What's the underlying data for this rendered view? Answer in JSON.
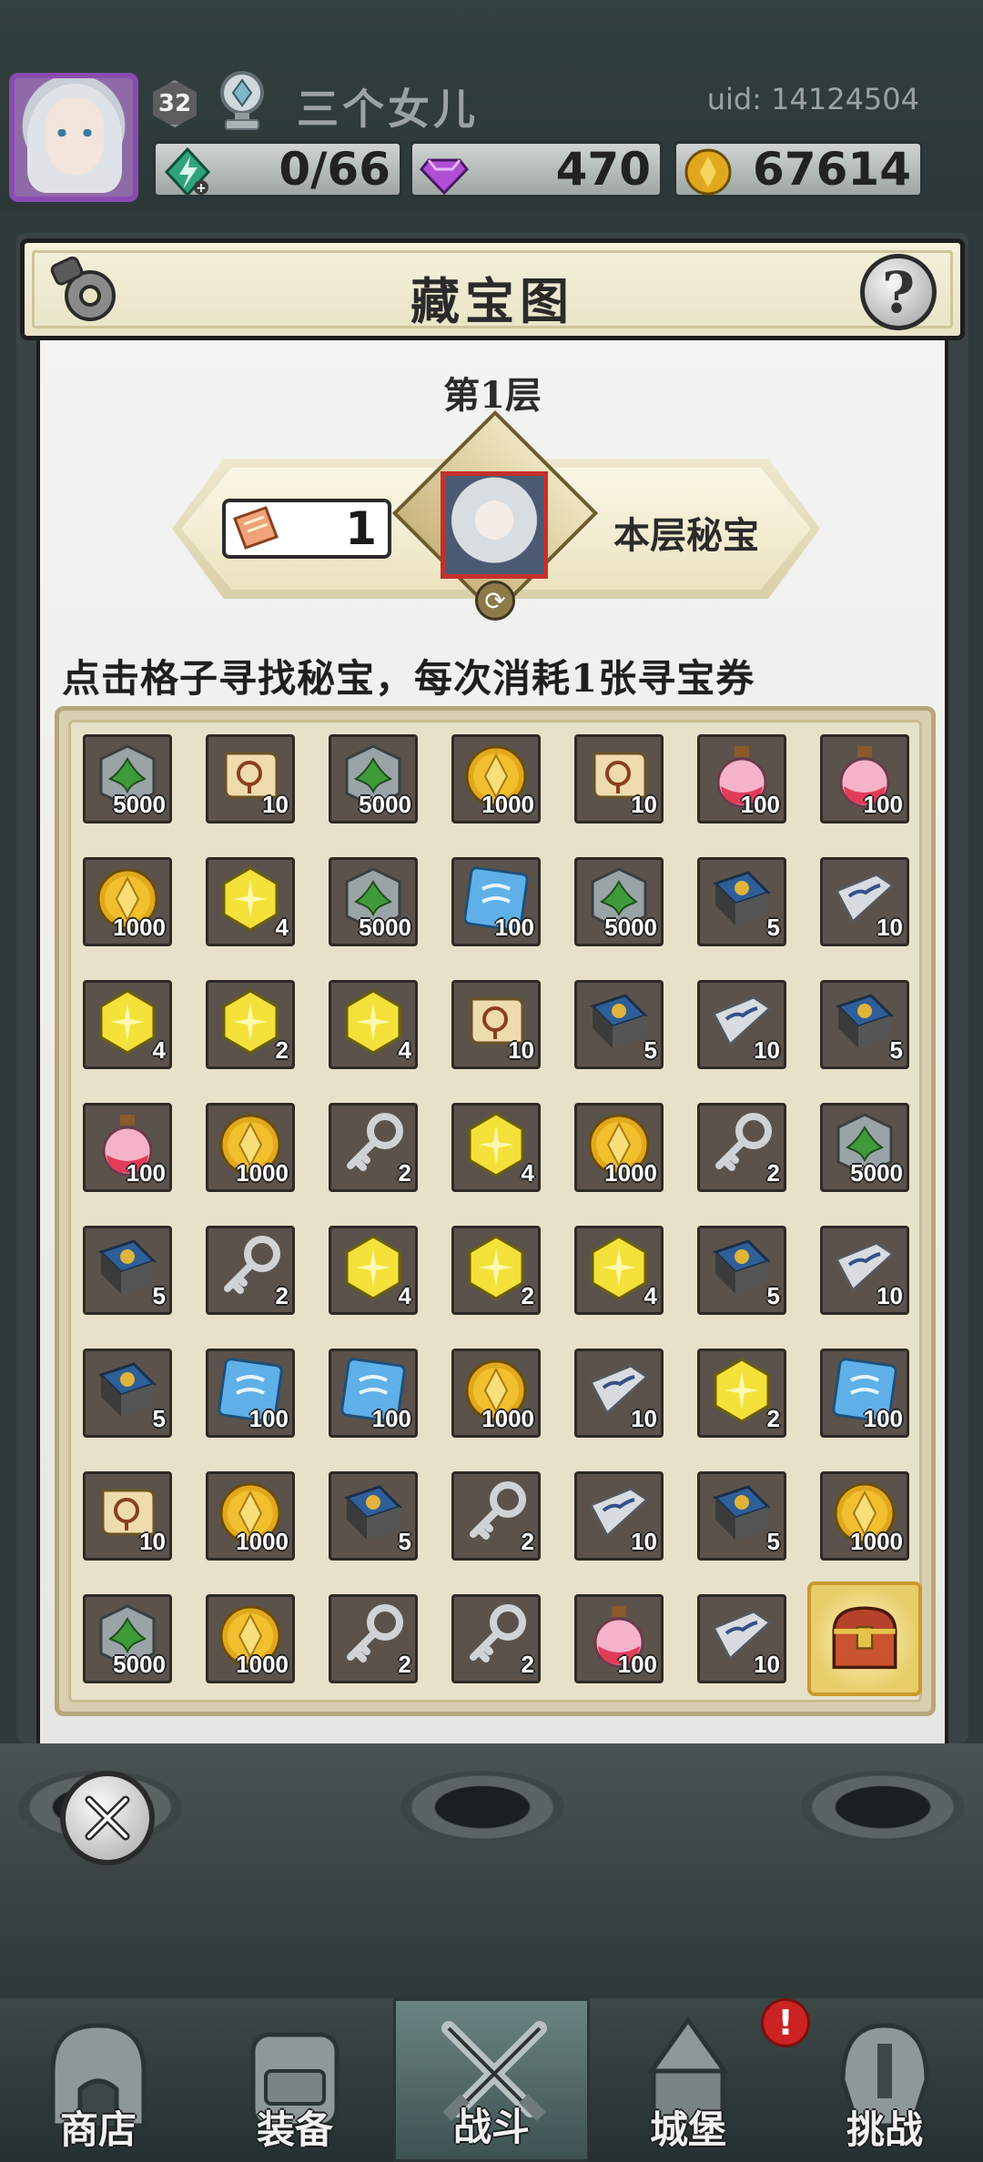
{
  "player": {
    "level": "32",
    "name": "三个女儿",
    "uid": "uid: 14124504"
  },
  "resources": {
    "energy": "0/66",
    "gems": "470",
    "gold": "67614"
  },
  "dialog": {
    "title": "藏宝图",
    "help_label": "?",
    "floor": "第1层",
    "ticket_count": "1",
    "secret_label": "本层秘宝",
    "instruction": "点击格子寻找秘宝，每次消耗1张寻宝券"
  },
  "grid": [
    [
      {
        "icon": "green-gem-icon",
        "qty": "5000"
      },
      {
        "icon": "scroll-icon",
        "qty": "10"
      },
      {
        "icon": "green-gem-icon",
        "qty": "5000"
      },
      {
        "icon": "gold-coin-icon",
        "qty": "1000"
      },
      {
        "icon": "scroll-icon",
        "qty": "10"
      },
      {
        "icon": "potion-icon",
        "qty": "100"
      },
      {
        "icon": "potion-icon",
        "qty": "100"
      }
    ],
    [
      {
        "icon": "gold-coin-icon",
        "qty": "1000"
      },
      {
        "icon": "yellow-crystal-icon",
        "qty": "4"
      },
      {
        "icon": "green-gem-icon",
        "qty": "5000"
      },
      {
        "icon": "blue-rune-icon",
        "qty": "100"
      },
      {
        "icon": "green-gem-icon",
        "qty": "5000"
      },
      {
        "icon": "spellbook-icon",
        "qty": "5"
      },
      {
        "icon": "silver-ingot-icon",
        "qty": "10"
      }
    ],
    [
      {
        "icon": "yellow-crystal-icon",
        "qty": "4"
      },
      {
        "icon": "yellow-crystal-icon",
        "qty": "2"
      },
      {
        "icon": "yellow-crystal-icon",
        "qty": "4"
      },
      {
        "icon": "scroll-icon",
        "qty": "10"
      },
      {
        "icon": "spellbook-icon",
        "qty": "5"
      },
      {
        "icon": "silver-ingot-icon",
        "qty": "10"
      },
      {
        "icon": "spellbook-icon",
        "qty": "5"
      }
    ],
    [
      {
        "icon": "potion-icon",
        "qty": "100"
      },
      {
        "icon": "gold-coin-icon",
        "qty": "1000"
      },
      {
        "icon": "key-icon",
        "qty": "2"
      },
      {
        "icon": "yellow-crystal-icon",
        "qty": "4"
      },
      {
        "icon": "gold-coin-icon",
        "qty": "1000"
      },
      {
        "icon": "key-icon",
        "qty": "2"
      },
      {
        "icon": "green-gem-icon",
        "qty": "5000"
      }
    ],
    [
      {
        "icon": "spellbook-icon",
        "qty": "5"
      },
      {
        "icon": "key-icon",
        "qty": "2"
      },
      {
        "icon": "yellow-crystal-icon",
        "qty": "4"
      },
      {
        "icon": "yellow-crystal-icon",
        "qty": "2"
      },
      {
        "icon": "yellow-crystal-icon",
        "qty": "4"
      },
      {
        "icon": "spellbook-icon",
        "qty": "5"
      },
      {
        "icon": "silver-ingot-icon",
        "qty": "10"
      }
    ],
    [
      {
        "icon": "spellbook-icon",
        "qty": "5"
      },
      {
        "icon": "blue-rune-icon",
        "qty": "100"
      },
      {
        "icon": "blue-rune-icon",
        "qty": "100"
      },
      {
        "icon": "gold-coin-icon",
        "qty": "1000"
      },
      {
        "icon": "silver-ingot-icon",
        "qty": "10"
      },
      {
        "icon": "yellow-crystal-icon",
        "qty": "2"
      },
      {
        "icon": "blue-rune-icon",
        "qty": "100"
      }
    ],
    [
      {
        "icon": "scroll-icon",
        "qty": "10"
      },
      {
        "icon": "gold-coin-icon",
        "qty": "1000"
      },
      {
        "icon": "spellbook-icon",
        "qty": "5"
      },
      {
        "icon": "key-icon",
        "qty": "2"
      },
      {
        "icon": "silver-ingot-icon",
        "qty": "10"
      },
      {
        "icon": "spellbook-icon",
        "qty": "5"
      },
      {
        "icon": "gold-coin-icon",
        "qty": "1000"
      }
    ],
    [
      {
        "icon": "green-gem-icon",
        "qty": "5000"
      },
      {
        "icon": "gold-coin-icon",
        "qty": "1000"
      },
      {
        "icon": "key-icon",
        "qty": "2"
      },
      {
        "icon": "key-icon",
        "qty": "2"
      },
      {
        "icon": "potion-icon",
        "qty": "100"
      },
      {
        "icon": "silver-ingot-icon",
        "qty": "10"
      },
      {
        "icon": "treasure-chest-icon",
        "qty": ""
      }
    ]
  ],
  "nav": [
    {
      "label": "商店",
      "icon": "shop-icon",
      "active": false
    },
    {
      "label": "装备",
      "icon": "backpack-icon",
      "active": false
    },
    {
      "label": "战斗",
      "icon": "crossed-swords-icon",
      "active": true
    },
    {
      "label": "城堡",
      "icon": "castle-icon",
      "active": false
    },
    {
      "label": "挑战",
      "icon": "helmet-icon",
      "active": false
    }
  ],
  "alert_badge": "!",
  "colors": {
    "background": "#2f3a3c",
    "panel": "#e8e1c9",
    "avatar_border": "#8a4bb0",
    "alert": "#cc2222"
  }
}
